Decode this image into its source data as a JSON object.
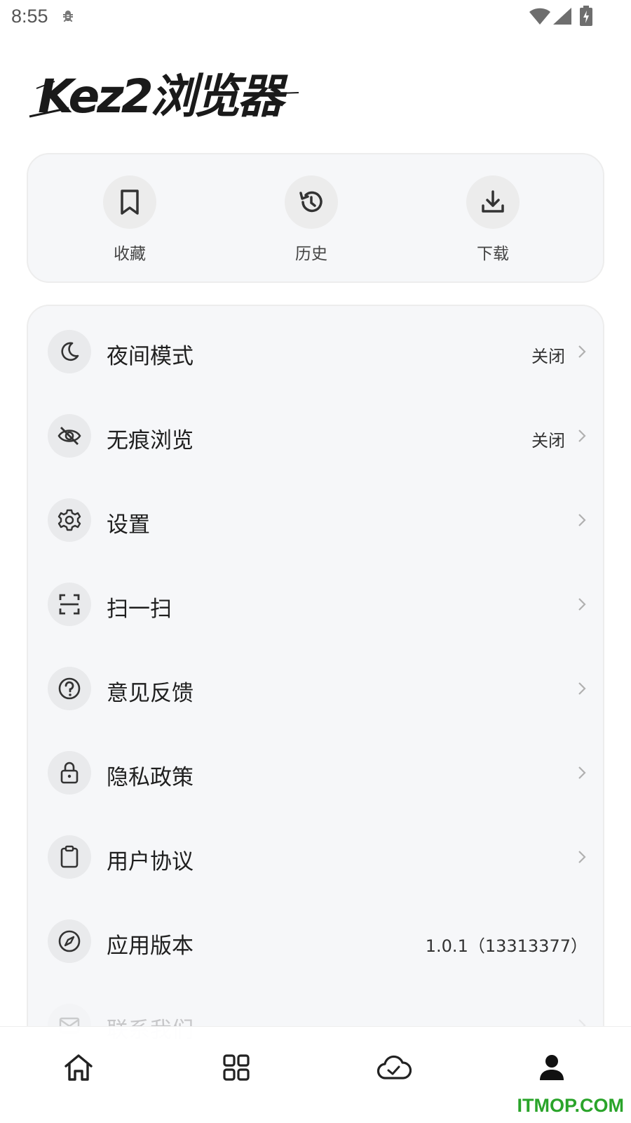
{
  "status_bar": {
    "time": "8:55"
  },
  "quick_actions": [
    {
      "label": "收藏",
      "icon": "bookmark-icon"
    },
    {
      "label": "历史",
      "icon": "history-icon"
    },
    {
      "label": "下载",
      "icon": "download-icon"
    }
  ],
  "menu": [
    {
      "label": "夜间模式",
      "value": "关闭",
      "icon": "moon-icon"
    },
    {
      "label": "无痕浏览",
      "value": "关闭",
      "icon": "eye-off-icon"
    },
    {
      "label": "设置",
      "value": "",
      "icon": "gear-icon"
    },
    {
      "label": "扫一扫",
      "value": "",
      "icon": "scan-icon"
    },
    {
      "label": "意见反馈",
      "value": "",
      "icon": "question-icon"
    },
    {
      "label": "隐私政策",
      "value": "",
      "icon": "lock-icon"
    },
    {
      "label": "用户协议",
      "value": "",
      "icon": "clipboard-icon"
    },
    {
      "label": "应用版本",
      "value": "1.0.1（13313377）",
      "icon": "compass-icon"
    },
    {
      "label": "联系我们",
      "value": "",
      "icon": "mail-icon"
    }
  ],
  "bottom_nav": [
    {
      "name": "home",
      "icon": "home-icon"
    },
    {
      "name": "apps",
      "icon": "grid-icon"
    },
    {
      "name": "cloud",
      "icon": "cloud-check-icon"
    },
    {
      "name": "profile",
      "icon": "user-icon",
      "active": true
    }
  ],
  "logo_text": "Kez2浏览器",
  "watermark": "ITMOP.COM",
  "colors": {
    "card_bg": "#f6f7f9",
    "icon_bg": "#e9eaec",
    "watermark": "#2aa42a"
  }
}
